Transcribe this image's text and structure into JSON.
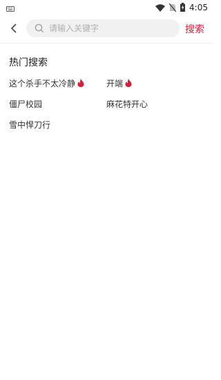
{
  "status_bar": {
    "time": "4:05",
    "icons": [
      "keyboard-icon",
      "wifi-icon",
      "no-sim-icon",
      "battery-charging-icon"
    ]
  },
  "search": {
    "placeholder": "请输入关键字",
    "button_label": "搜索"
  },
  "hot_search": {
    "title": "热门搜索",
    "items": [
      {
        "label": "这个杀手不太冷静",
        "hot": true
      },
      {
        "label": "开端",
        "hot": true
      },
      {
        "label": "僵尸校园",
        "hot": false
      },
      {
        "label": "麻花特开心",
        "hot": false
      },
      {
        "label": "雪中悍刀行",
        "hot": false
      }
    ]
  },
  "colors": {
    "accent": "#d0213b",
    "search_bg": "#f1f1f1"
  }
}
